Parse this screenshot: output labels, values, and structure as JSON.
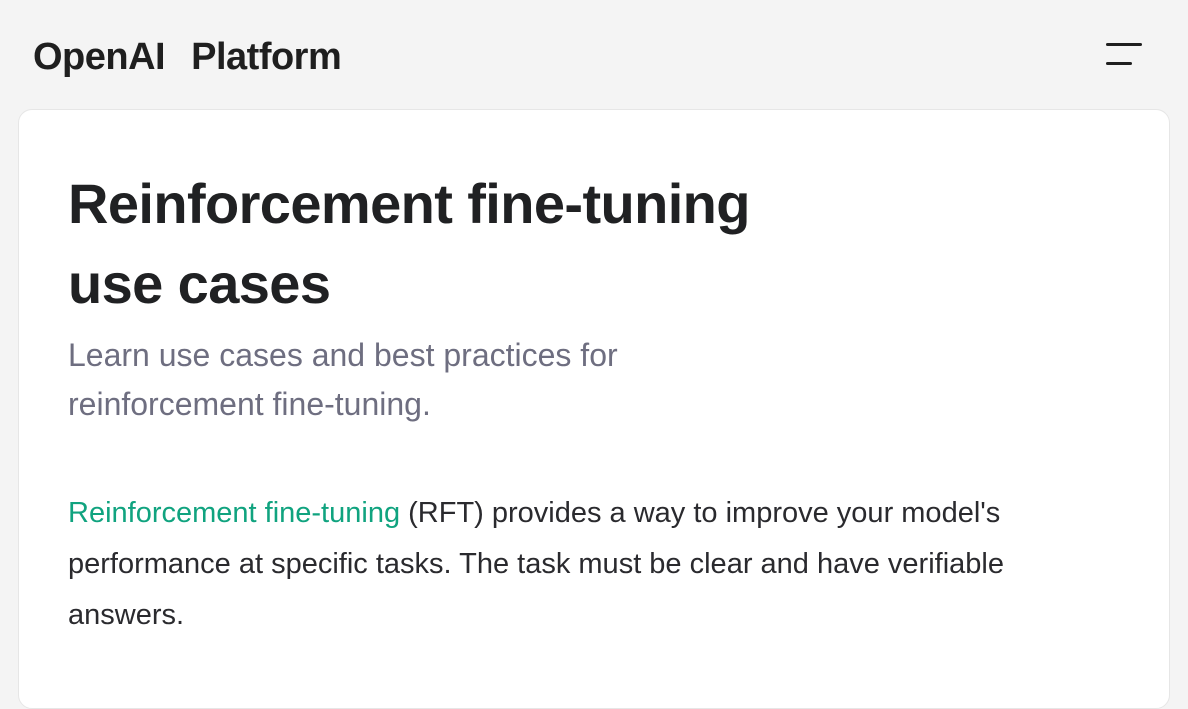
{
  "header": {
    "brand_primary": "OpenAI",
    "brand_secondary": "Platform",
    "menu_icon": "menu-icon"
  },
  "article": {
    "title": "Reinforcement fine-tuning use cases",
    "subtitle": "Learn use cases and best practices for reinforcement fine-tuning.",
    "intro": {
      "link_text": "Reinforcement fine-tuning",
      "rest_text": " (RFT) provides a way to improve your model's performance at specific tasks. The task must be clear and have verifiable answers."
    }
  },
  "colors": {
    "link": "#10a37f",
    "title": "#202123",
    "subtitle": "#6e6e80",
    "background": "#f4f4f4",
    "card": "#ffffff"
  }
}
